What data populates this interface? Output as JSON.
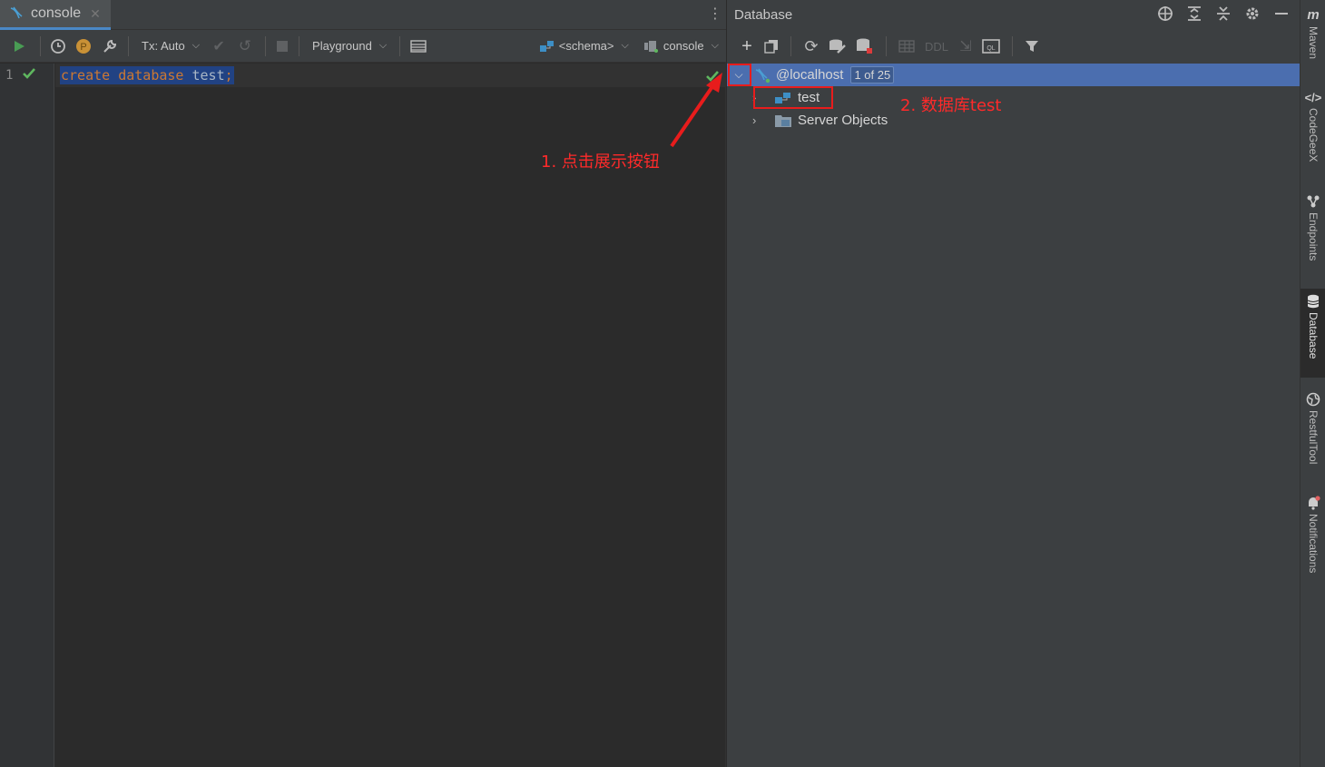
{
  "editor": {
    "tab_label": "console",
    "toolbar": {
      "tx_label": "Tx: Auto",
      "playground_label": "Playground",
      "schema_label": "<schema>",
      "console_label": "console"
    },
    "line_number": "1",
    "code": {
      "kw1": "create",
      "kw2": "database",
      "ident": "test",
      "semi": ";"
    }
  },
  "database": {
    "title": "Database",
    "toolbar": {
      "ddl_label": "DDL"
    },
    "tree": {
      "localhost_label": "@localhost",
      "localhost_badge": "1 of 25",
      "test_label": "test",
      "server_objects_label": "Server Objects"
    }
  },
  "annotations": {
    "click_expand": "1. 点击展示按钮",
    "database_test": "2. 数据库test"
  },
  "stripe": {
    "maven": "Maven",
    "codegeex": "CodeGeeX",
    "endpoints": "Endpoints",
    "database": "Database",
    "restfultool": "RestfulTool",
    "notifications": "Notifications"
  },
  "colors": {
    "accent": "#4a88c7",
    "selection": "#4b6eaf",
    "run_green": "#499c54",
    "annotation_red": "#e81c1c"
  }
}
